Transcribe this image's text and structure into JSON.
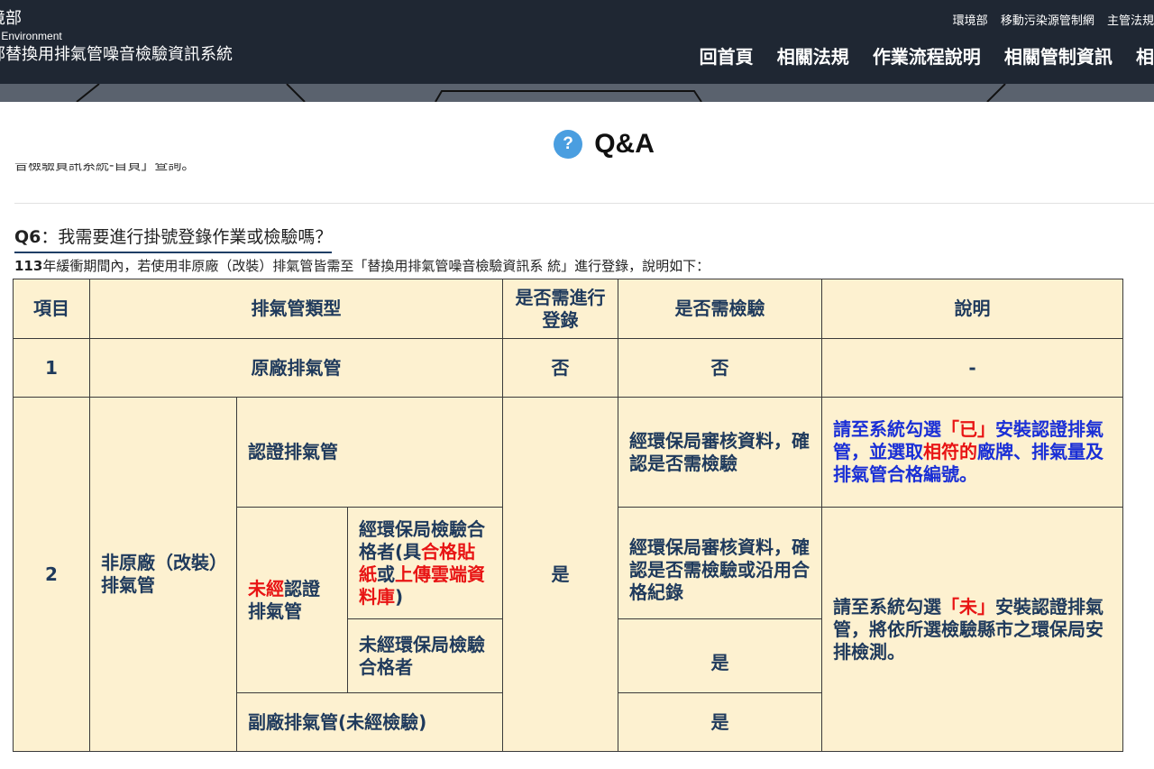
{
  "header": {
    "brand_line1": "境部",
    "brand_line2": "of Environment",
    "brand_line3": "部替換用排氣管噪音檢驗資訊系統",
    "top_links": [
      "環境部",
      "移動污染源管制網",
      "主管法規"
    ],
    "nav": [
      "回首頁",
      "相關法規",
      "作業流程說明",
      "相關管制資訊",
      "相"
    ]
  },
  "page": {
    "qa_icon": "?",
    "qa_title": "Q&A",
    "cut_text": "音檢驗資訊系統-首頁」查詢。"
  },
  "question": {
    "number": "Q6",
    "text": "：我需要進行掛號登錄作業或檢驗嗎？",
    "intro_year": "113",
    "intro_rest": "年緩衝期間內，若使用非原廠（改裝）排氣管皆需至「替換用排氣管噪音檢驗資訊系 統」進行登錄，說明如下："
  },
  "table": {
    "headers": {
      "item": "項目",
      "type": "排氣管類型",
      "register": "是否需進行登錄",
      "inspect": "是否需檢驗",
      "note": "說明"
    },
    "row1": {
      "item": "1",
      "type": "原廠排氣管",
      "register": "否",
      "inspect": "否",
      "note": "-"
    },
    "row2": {
      "item": "2",
      "type": "非原廠（改裝）排氣管",
      "certified": "認證排氣管",
      "certified_inspect": "經環保局審核資料，確認是否需檢驗",
      "certified_note_a": "請至系統勾選",
      "certified_note_b": "「已」",
      "certified_note_c": "安裝認證排氣管，並選取",
      "certified_note_d": "相符的",
      "certified_note_e": "廠牌、排氣量及排氣管合格編號。",
      "uncert_a": "未經",
      "uncert_b": "認證排氣管",
      "passed_a": "經環保局檢驗合格者(具",
      "passed_b": "合格貼紙",
      "passed_c": "或",
      "passed_d": "上傳雲端資料庫",
      "passed_e": ")",
      "register": "是",
      "passed_inspect": "經環保局審核資料，確認是否需檢驗或沿用合格紀錄",
      "not_passed": "未經環保局檢驗合格者",
      "not_passed_inspect": "是",
      "sub_factory": "副廠排氣管(未經檢驗)",
      "sub_factory_inspect": "是",
      "uncert_note_a": "請至系統勾選",
      "uncert_note_b": "「未」",
      "uncert_note_c": "安裝認證排氣管，將依所選檢驗縣市之環保局安排檢測。"
    }
  }
}
